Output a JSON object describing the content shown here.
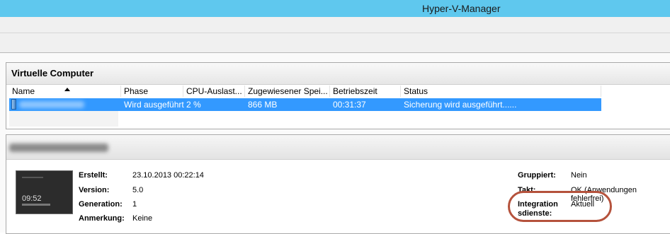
{
  "window": {
    "title": "Hyper-V-Manager"
  },
  "vm_panel": {
    "title": "Virtuelle Computer",
    "columns": [
      "Name",
      "Phase",
      "CPU-Auslast...",
      "Zugewiesener Spei...",
      "Betriebszeit",
      "Status"
    ],
    "rows": [
      {
        "name": "",
        "phase": "Wird ausgeführt",
        "cpu": "2 %",
        "memory": "866 MB",
        "uptime": "00:31:37",
        "status": "Sicherung wird ausgeführt......"
      }
    ]
  },
  "details": {
    "thumbnail": {
      "time": "09:52"
    },
    "left": [
      {
        "label": "Erstellt:",
        "value": "23.10.2013 00:22:14"
      },
      {
        "label": "Version:",
        "value": "5.0"
      },
      {
        "label": "Generation:",
        "value": "1"
      },
      {
        "label": "Anmerkung:",
        "value": "Keine"
      }
    ],
    "right": [
      {
        "label": "Gruppiert:",
        "value": "Nein"
      },
      {
        "label": "Takt:",
        "value": "OK (Anwendungen fehlerfrei)"
      },
      {
        "label": "Integration sdienste:",
        "value": "Aktuell"
      }
    ]
  },
  "colors": {
    "titlebar": "#5fc8ee",
    "selection": "#3399ff",
    "highlight_ring": "#b5523c"
  }
}
